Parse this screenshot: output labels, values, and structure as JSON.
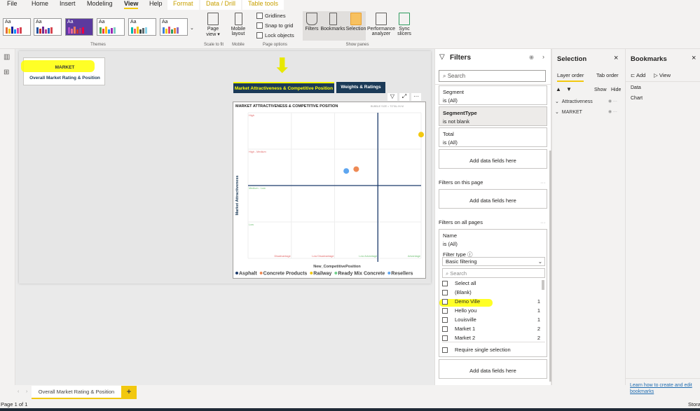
{
  "menu": {
    "tabs": [
      "File",
      "Home",
      "Insert",
      "Modeling",
      "View",
      "Help",
      "Format",
      "Data / Drill",
      "Table tools"
    ],
    "active": "View"
  },
  "ribbon": {
    "themes_label": "Themes",
    "theme_sample": "Aa",
    "page_view": "Page view",
    "scale_to_fit": "Scale to fit",
    "mobile_layout": "Mobile layout",
    "mobile": "Mobile",
    "gridlines": "Gridlines",
    "snap_to_grid": "Snap to grid",
    "lock_objects": "Lock objects",
    "page_options": "Page options",
    "filters": "Filters",
    "bookmarks": "Bookmarks",
    "selection": "Selection",
    "performance_analyzer": "Performance analyzer",
    "sync_slicers": "Sync slicers",
    "show_panes": "Show panes"
  },
  "canvas": {
    "card": {
      "title": "MARKET",
      "subtitle": "Overall Market Rating & Position"
    },
    "buttons": [
      "Market Attractiveness & Competitive Position",
      "Weights & Ratings"
    ]
  },
  "chart_data": {
    "type": "scatter",
    "title": "MARKET ATTRACTIVENESS & COMPETITIVE POSITION",
    "subtitle": "BUBBLE SIZE = TOTAL IN M",
    "xlabel": "New_CompetitivePosition",
    "ylabel": "Market Attractiveness",
    "xlim": [
      0,
      4
    ],
    "ylim": [
      0,
      4
    ],
    "x_tick_labels": [
      "Disadvantage",
      "Low Disadvantage",
      "Low Advantage",
      "Advantage"
    ],
    "y_tick_labels": [
      "Low",
      "Medium - Low",
      "High - Medium",
      "High"
    ],
    "reference_lines": {
      "x": 3,
      "y": 2
    },
    "series": [
      {
        "name": "Asphalt",
        "color": "#1b3a6b",
        "points": []
      },
      {
        "name": "Concrete Products",
        "color": "#ee8a55",
        "points": [
          [
            2.5,
            2.45
          ]
        ]
      },
      {
        "name": "Railway",
        "color": "#f2c80f",
        "points": [
          [
            4.0,
            3.4
          ]
        ]
      },
      {
        "name": "Ready Mix Concrete",
        "color": "#6fcf8a",
        "points": []
      },
      {
        "name": "Resellers",
        "color": "#5ea6f0",
        "points": [
          [
            2.27,
            2.4
          ]
        ]
      }
    ]
  },
  "filters": {
    "title": "Filters",
    "search_placeholder": "Search",
    "visual_filters": [
      {
        "name": "Segment",
        "state": "is (All)"
      },
      {
        "name": "SegmentType",
        "state": "is not blank"
      },
      {
        "name": "Total",
        "state": "is (All)"
      }
    ],
    "add_fields": "Add data fields here",
    "on_this_page": "Filters on this page",
    "on_all_pages": "Filters on all pages",
    "name_filter": {
      "name": "Name",
      "state": "is (All)",
      "filter_type_label": "Filter type",
      "filter_type": "Basic filtering",
      "search_placeholder": "Search",
      "items": [
        {
          "label": "Select all",
          "count": ""
        },
        {
          "label": "(Blank)",
          "count": ""
        },
        {
          "label": "Demo Ville",
          "count": "1"
        },
        {
          "label": "Hello you",
          "count": "1"
        },
        {
          "label": "Louisville",
          "count": "1"
        },
        {
          "label": "Market 1",
          "count": "2"
        },
        {
          "label": "Market 2",
          "count": "2"
        }
      ],
      "require_single": "Require single selection"
    }
  },
  "selection": {
    "title": "Selection",
    "tabs": [
      "Layer order",
      "Tab order"
    ],
    "show": "Show",
    "hide": "Hide",
    "layers": [
      "Attractiveness",
      "MARKET"
    ]
  },
  "bookmarks": {
    "title": "Bookmarks",
    "add": "Add",
    "view": "View",
    "items": [
      "Data",
      "Chart"
    ],
    "help_link": "Learn how to create and edit bookmarks"
  },
  "page_tabs": {
    "current": "Overall Market Rating & Position",
    "add": "+"
  },
  "status": {
    "page": "Page 1 of 1",
    "right": "Stora"
  },
  "colors": {
    "accent": "#f2c80f",
    "highlight": "#ffff00",
    "button_bg": "#1b3a57"
  }
}
